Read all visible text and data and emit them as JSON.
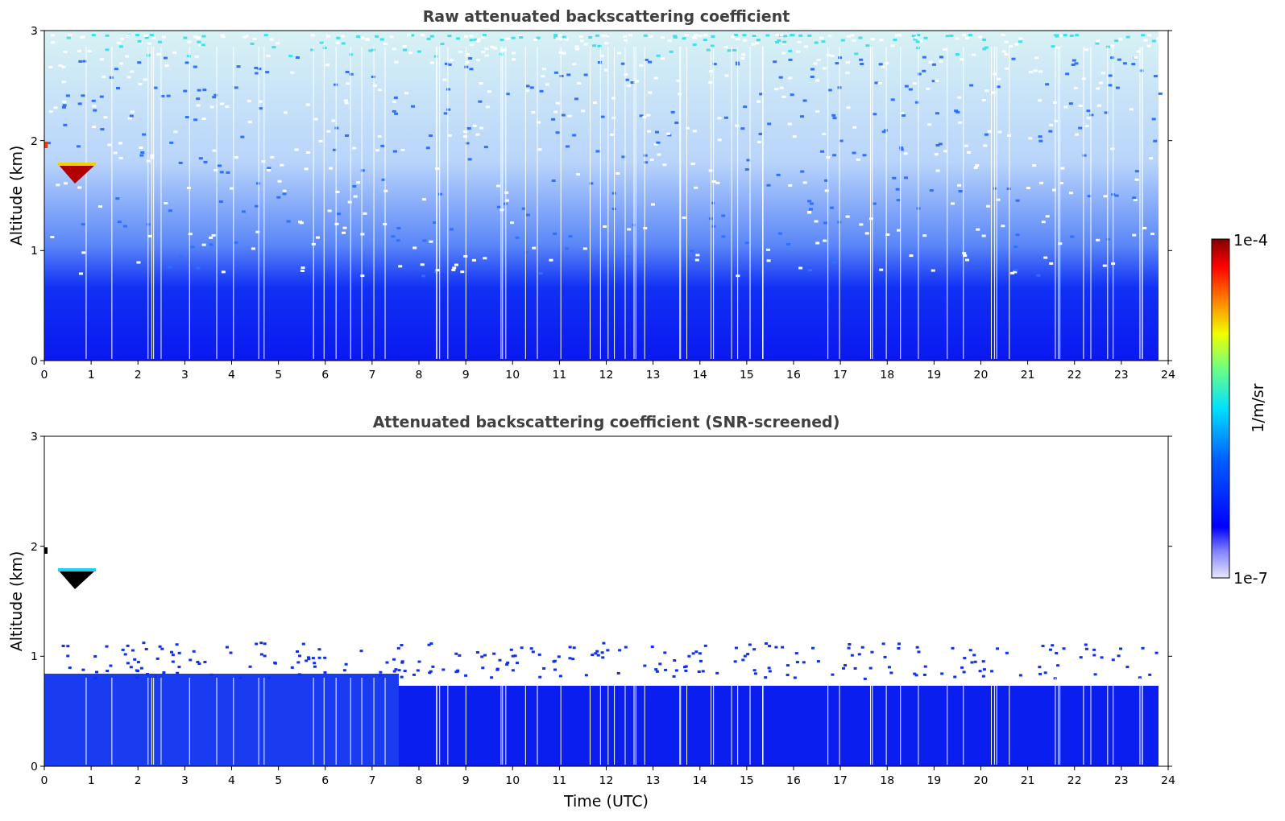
{
  "panels": [
    {
      "kind": "raw",
      "title": "Raw attenuated backscattering coefficient",
      "ylabel": "Altitude (km)",
      "yticks": [
        "3",
        "2",
        "1",
        "0"
      ],
      "xticks": [
        "0",
        "1",
        "2",
        "3",
        "4",
        "5",
        "6",
        "7",
        "8",
        "9",
        "10",
        "11",
        "12",
        "13",
        "14",
        "15",
        "16",
        "17",
        "18",
        "19",
        "20",
        "21",
        "22",
        "23",
        "24"
      ]
    },
    {
      "kind": "screened",
      "title": "Attenuated backscattering coefficient (SNR-screened)",
      "ylabel": "Altitude (km)",
      "yticks": [
        "3",
        "2",
        "1",
        "0"
      ],
      "xticks": [
        "0",
        "1",
        "2",
        "3",
        "4",
        "5",
        "6",
        "7",
        "8",
        "9",
        "10",
        "11",
        "12",
        "13",
        "14",
        "15",
        "16",
        "17",
        "18",
        "19",
        "20",
        "21",
        "22",
        "23",
        "24"
      ],
      "xlabel": "Time (UTC)"
    }
  ],
  "colorbar": {
    "max_label": "1e-4",
    "min_label": "1e-7",
    "unit": "1/m/sr"
  }
}
